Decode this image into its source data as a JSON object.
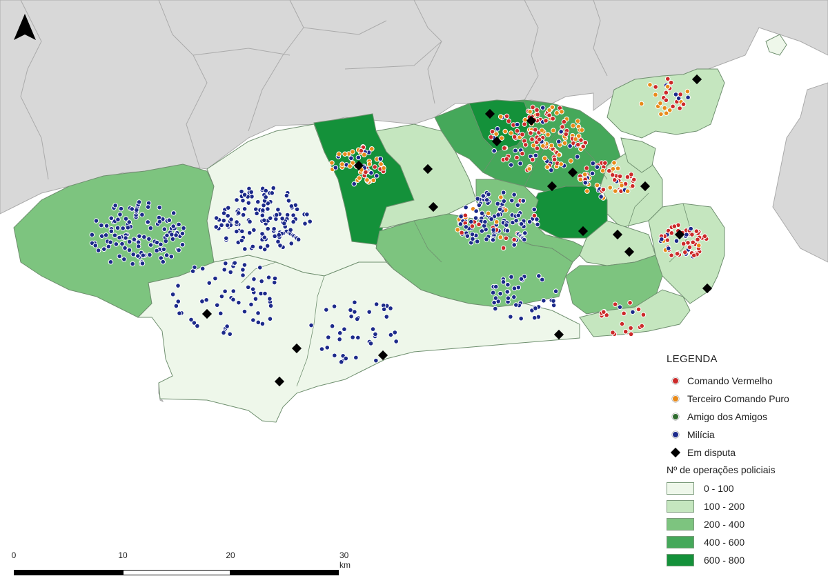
{
  "legend": {
    "title": "LEGENDA",
    "factions": [
      {
        "label": "Comando Vermelho",
        "color": "#cc2a2a",
        "symbol": "dot"
      },
      {
        "label": "Terceiro Comando Puro",
        "color": "#e88a1a",
        "symbol": "dot"
      },
      {
        "label": "Amigo dos Amigos",
        "color": "#2e6b2e",
        "symbol": "dot"
      },
      {
        "label": "Milícia",
        "color": "#1c2a8a",
        "symbol": "dot"
      },
      {
        "label": "Em disputa",
        "color": "#000000",
        "symbol": "diamond"
      }
    ],
    "ramp_title": "Nº de operações policiais",
    "ramp": [
      {
        "label": "0 - 100",
        "color": "#eef7ea"
      },
      {
        "label": "100 - 200",
        "color": "#c5e6bf"
      },
      {
        "label": "200 - 400",
        "color": "#7dc47f"
      },
      {
        "label": "400 - 600",
        "color": "#45a85a"
      },
      {
        "label": "600 - 800",
        "color": "#14913a"
      }
    ]
  },
  "scale_bar": {
    "labels": [
      "0",
      "10",
      "20",
      "30 km"
    ]
  },
  "north_arrow": {
    "icon": "north-arrow-icon"
  }
}
